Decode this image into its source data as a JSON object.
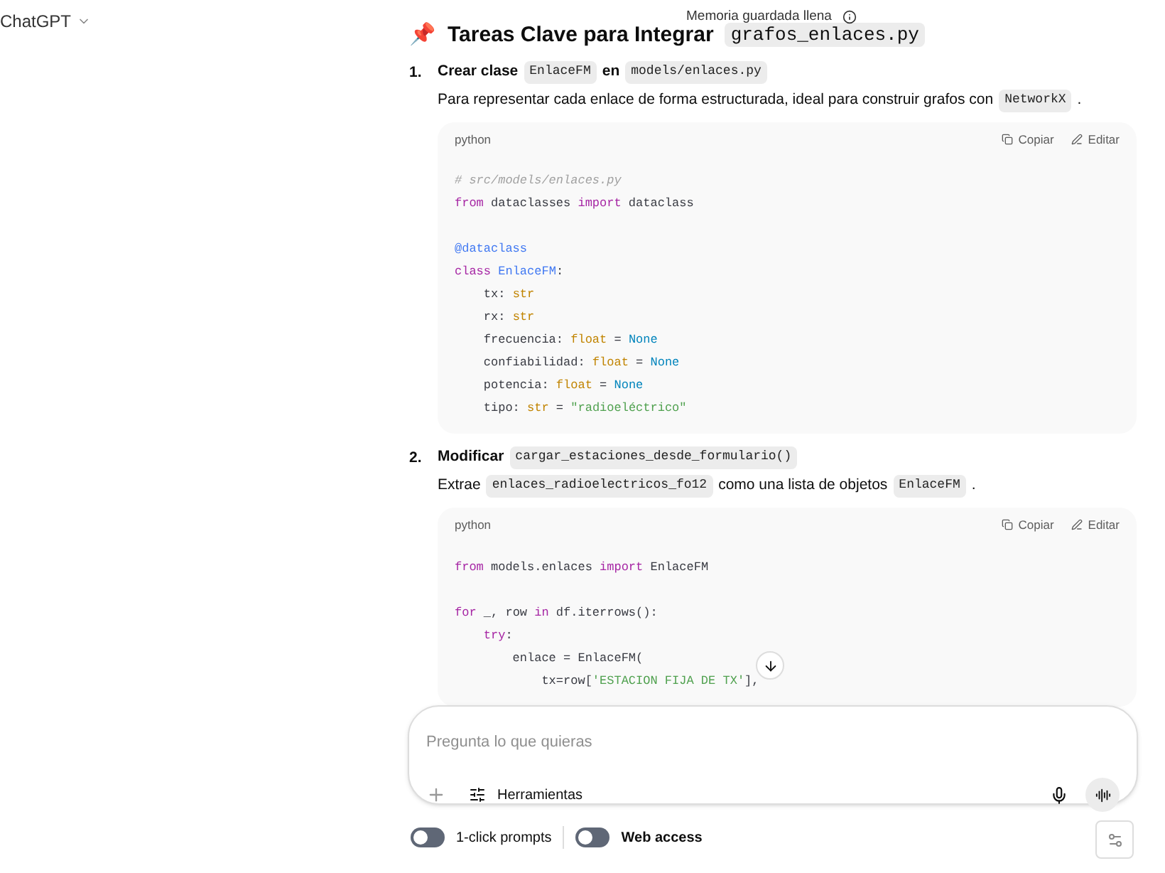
{
  "header": {
    "model": "ChatGPT",
    "notice": "Memoria guardada llena"
  },
  "heading": {
    "emoji": "📌",
    "text": "Tareas Clave para Integrar",
    "code": "grafos_enlaces.py"
  },
  "steps": [
    {
      "number": "1.",
      "title": [
        {
          "t": "Crear clase",
          "code": false
        },
        {
          "t": "EnlaceFM",
          "code": true
        },
        {
          "t": "en",
          "code": false
        },
        {
          "t": "models/enlaces.py",
          "code": true
        }
      ],
      "desc": [
        {
          "t": "Para representar cada enlace de forma estructurada, ideal para construir grafos con",
          "code": false
        },
        {
          "t": "NetworkX",
          "code": true
        },
        {
          "t": ".",
          "code": false
        }
      ],
      "block": {
        "lang": "python",
        "copy": "Copiar",
        "edit": "Editar",
        "lines": [
          {
            "kind": "code",
            "segs": [
              {
                "t": "# src/models/enlaces.py",
                "kind": "comment"
              }
            ]
          },
          {
            "kind": "code",
            "segs": [
              {
                "t": "from",
                "kind": "keyword"
              },
              {
                "t": " dataclasses ",
                "kind": "plain"
              },
              {
                "t": "import",
                "kind": "keyword"
              },
              {
                "t": " dataclass",
                "kind": "plain"
              }
            ]
          },
          {
            "kind": "blank"
          },
          {
            "kind": "code",
            "segs": [
              {
                "t": "@dataclass",
                "kind": "decorator"
              }
            ]
          },
          {
            "kind": "code",
            "segs": [
              {
                "t": "class",
                "kind": "keyword"
              },
              {
                "t": " EnlaceFM",
                "kind": "decorator"
              },
              {
                "t": ":",
                "kind": "plain"
              }
            ]
          },
          {
            "kind": "code",
            "segs": [
              {
                "t": "    tx: ",
                "kind": "plain"
              },
              {
                "t": "str",
                "kind": "type"
              }
            ]
          },
          {
            "kind": "code",
            "segs": [
              {
                "t": "    rx: ",
                "kind": "plain"
              },
              {
                "t": "str",
                "kind": "type"
              }
            ]
          },
          {
            "kind": "code",
            "segs": [
              {
                "t": "    frecuencia: ",
                "kind": "plain"
              },
              {
                "t": "float",
                "kind": "type"
              },
              {
                "t": " = ",
                "kind": "plain"
              },
              {
                "t": "None",
                "kind": "const"
              }
            ]
          },
          {
            "kind": "code",
            "segs": [
              {
                "t": "    confiabilidad: ",
                "kind": "plain"
              },
              {
                "t": "float",
                "kind": "type"
              },
              {
                "t": " = ",
                "kind": "plain"
              },
              {
                "t": "None",
                "kind": "const"
              }
            ]
          },
          {
            "kind": "code",
            "segs": [
              {
                "t": "    potencia: ",
                "kind": "plain"
              },
              {
                "t": "float",
                "kind": "type"
              },
              {
                "t": " = ",
                "kind": "plain"
              },
              {
                "t": "None",
                "kind": "const"
              }
            ]
          },
          {
            "kind": "code",
            "segs": [
              {
                "t": "    tipo: ",
                "kind": "plain"
              },
              {
                "t": "str",
                "kind": "type"
              },
              {
                "t": " = ",
                "kind": "plain"
              },
              {
                "t": "\"radioeléctrico\"",
                "kind": "string"
              }
            ]
          }
        ]
      }
    },
    {
      "number": "2.",
      "title": [
        {
          "t": "Modificar",
          "code": false
        },
        {
          "t": "cargar_estaciones_desde_formulario()",
          "code": true
        }
      ],
      "desc": [
        {
          "t": "Extrae",
          "code": false
        },
        {
          "t": "enlaces_radioelectricos_fo12",
          "code": true
        },
        {
          "t": "como una lista de objetos",
          "code": false
        },
        {
          "t": "EnlaceFM",
          "code": true
        },
        {
          "t": ".",
          "code": false
        }
      ],
      "block": {
        "lang": "python",
        "copy": "Copiar",
        "edit": "Editar",
        "lines": [
          {
            "kind": "code",
            "segs": [
              {
                "t": "from",
                "kind": "keyword"
              },
              {
                "t": " models.enlaces ",
                "kind": "plain"
              },
              {
                "t": "import",
                "kind": "keyword"
              },
              {
                "t": " EnlaceFM",
                "kind": "plain"
              }
            ]
          },
          {
            "kind": "blank"
          },
          {
            "kind": "code",
            "segs": [
              {
                "t": "for",
                "kind": "keyword"
              },
              {
                "t": " _, row ",
                "kind": "plain"
              },
              {
                "t": "in",
                "kind": "keyword"
              },
              {
                "t": " df.iterrows():",
                "kind": "plain"
              }
            ]
          },
          {
            "kind": "code",
            "segs": [
              {
                "t": "    try",
                "kind": "keyword"
              },
              {
                "t": ":",
                "kind": "plain"
              }
            ]
          },
          {
            "kind": "code",
            "segs": [
              {
                "t": "        enlace = EnlaceFM(",
                "kind": "plain"
              }
            ]
          },
          {
            "kind": "code",
            "segs": [
              {
                "t": "            tx=row[",
                "kind": "plain"
              },
              {
                "t": "'ESTACION FIJA DE TX'",
                "kind": "string"
              },
              {
                "t": "],",
                "kind": "plain"
              }
            ]
          }
        ]
      }
    }
  ],
  "composer": {
    "placeholder": "Pregunta lo que quieras",
    "tools": "Herramientas"
  },
  "toggles": [
    {
      "label": "1-click prompts",
      "on": false,
      "bold": false
    },
    {
      "label": "Web access",
      "on": false,
      "bold": true
    }
  ]
}
